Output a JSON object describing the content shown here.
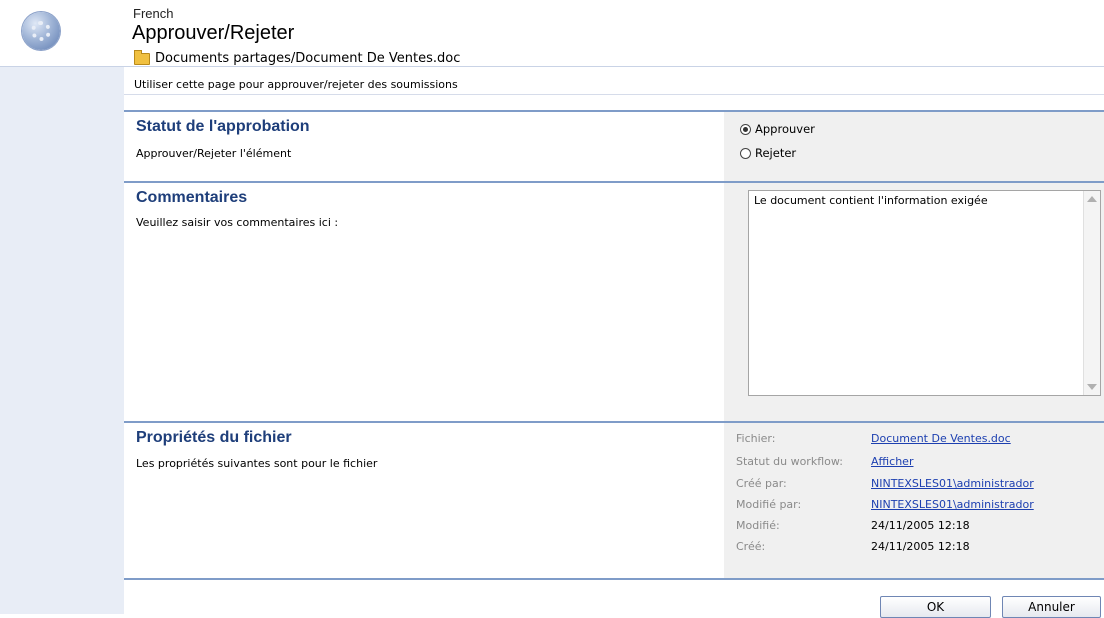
{
  "header": {
    "language": "French",
    "title": "Approuver/Rejeter",
    "breadcrumb": "Documents partages/Document De Ventes.doc"
  },
  "page_description": "Utiliser cette page pour approuver/rejeter des soumissions",
  "approval": {
    "title": "Statut de l'approbation",
    "description": "Approuver/Rejeter l'élément",
    "options": [
      {
        "label": "Approuver",
        "selected": true
      },
      {
        "label": "Rejeter",
        "selected": false
      }
    ]
  },
  "comments": {
    "title": "Commentaires",
    "description": "Veuillez saisir vos commentaires ici :",
    "value": "Le document contient l'information exigée"
  },
  "properties": {
    "title": "Propriétés du fichier",
    "description": "Les propriétés suivantes sont pour le fichier",
    "rows": [
      {
        "label": "Fichier:",
        "value": "Document De Ventes.doc",
        "link": true
      },
      {
        "label": "Statut du workflow:",
        "value": "Afficher",
        "link": true
      },
      {
        "label": "Créé par:",
        "value": "NINTEXSLES01\\administrador",
        "link": true
      },
      {
        "label": "Modifié par:",
        "value": "NINTEXSLES01\\administrador",
        "link": true
      },
      {
        "label": "Modifié:",
        "value": "24/11/2005 12:18",
        "link": false
      },
      {
        "label": "Créé:",
        "value": "24/11/2005 12:18",
        "link": false
      }
    ]
  },
  "buttons": {
    "ok": "OK",
    "cancel": "Annuler"
  },
  "colors": {
    "section_title": "#1e3e7a",
    "link": "#1c3fb0",
    "separator": "#7f9cc8",
    "left_strip": "#e8edf6",
    "right_panel": "#f0f0f0"
  }
}
